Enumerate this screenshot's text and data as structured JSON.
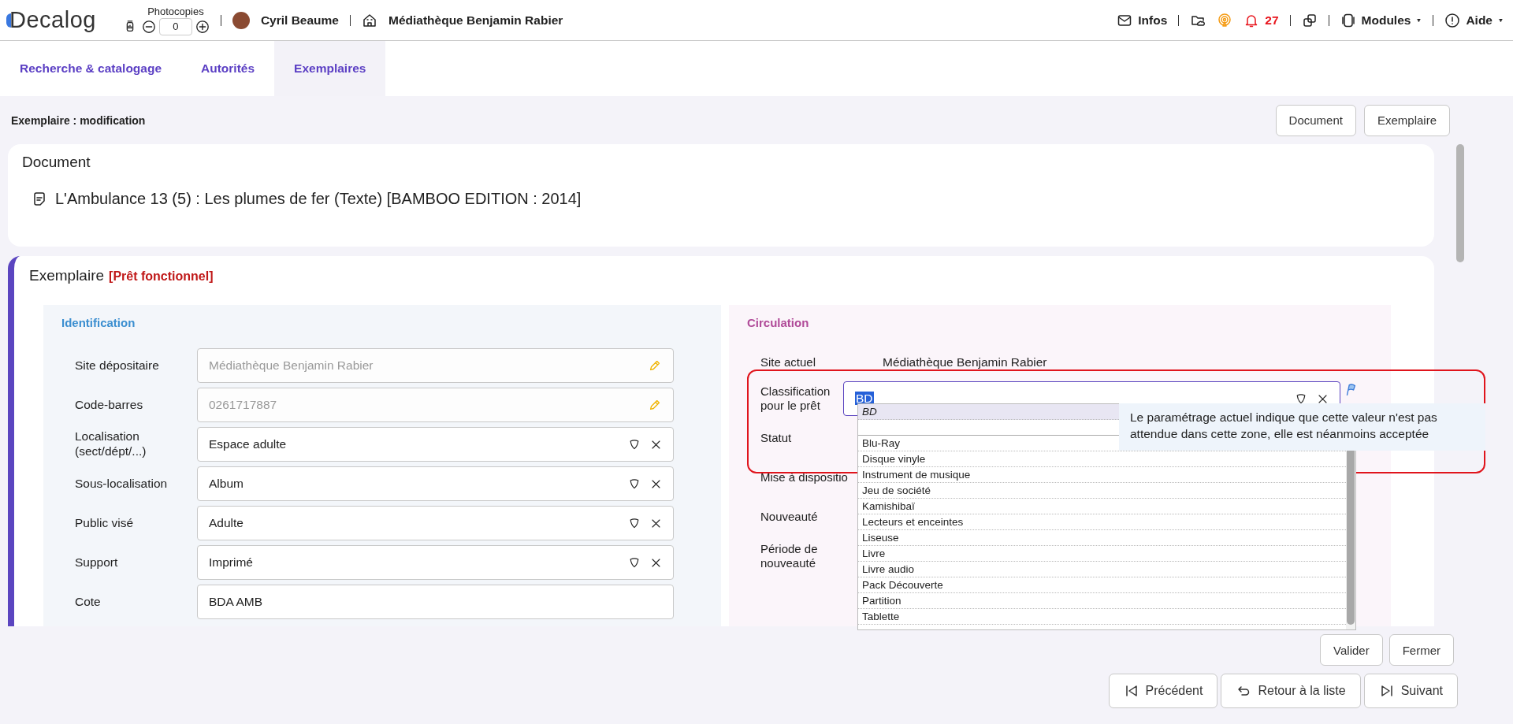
{
  "header": {
    "logo": "Decalog",
    "photocopies_label": "Photocopies",
    "photocopies_value": "0",
    "user": "Cyril Beaume",
    "library": "Médiathèque Benjamin Rabier",
    "infos": "Infos",
    "notifications": "27",
    "modules": "Modules",
    "help": "Aide"
  },
  "tabs": [
    {
      "label": "Recherche & catalogage",
      "selected": false
    },
    {
      "label": "Autorités",
      "selected": false
    },
    {
      "label": "Exemplaires",
      "selected": true
    }
  ],
  "page_title": "Exemplaire : modification",
  "top_buttons": [
    "Document",
    "Exemplaire"
  ],
  "document": {
    "title": "Document",
    "text": "L'Ambulance 13 (5) : Les plumes de fer (Texte) [BAMBOO EDITION : 2014]"
  },
  "exemplaire": {
    "title": "Exemplaire",
    "status": "[Prêt fonctionnel]",
    "identification": {
      "title": "Identification",
      "fields": [
        {
          "label": "Site dépositaire",
          "value": "Médiathèque Benjamin Rabier",
          "kind": "readonly"
        },
        {
          "label": "Code-barres",
          "value": "0261717887",
          "kind": "readonly"
        },
        {
          "label": "Localisation (sect/dépt/...)",
          "value": "Espace adulte",
          "kind": "select"
        },
        {
          "label": "Sous-localisation",
          "value": "Album",
          "kind": "select"
        },
        {
          "label": "Public visé",
          "value": "Adulte",
          "kind": "select"
        },
        {
          "label": "Support",
          "value": "Imprimé",
          "kind": "select"
        },
        {
          "label": "Cote",
          "value": "BDA AMB",
          "kind": "text"
        }
      ]
    },
    "circulation": {
      "title": "Circulation",
      "fields": [
        {
          "label": "Site actuel",
          "value": "Médiathèque Benjamin Rabier",
          "kind": "static"
        },
        {
          "label": "Classification pour le prêt",
          "value": "BD",
          "kind": "combo",
          "highlighted": true
        },
        {
          "label": "Statut",
          "kind": "hidden"
        },
        {
          "label": "Mise à dispositio",
          "kind": "covered"
        },
        {
          "label": "Nouveauté",
          "kind": "hidden"
        },
        {
          "label": "Période de nouveauté",
          "kind": "hidden"
        }
      ]
    }
  },
  "dropdown": {
    "items": [
      {
        "label": "BD",
        "selected": true
      },
      {
        "label": "Blu-Ray",
        "selected": false
      },
      {
        "label": "Disque vinyle",
        "selected": false
      },
      {
        "label": "Instrument de musique",
        "selected": false
      },
      {
        "label": "Jeu de société",
        "selected": false
      },
      {
        "label": "Kamishibaï",
        "selected": false
      },
      {
        "label": "Lecteurs et enceintes",
        "selected": false
      },
      {
        "label": "Liseuse",
        "selected": false
      },
      {
        "label": "Livre",
        "selected": false
      },
      {
        "label": "Livre audio",
        "selected": false
      },
      {
        "label": "Pack Découverte",
        "selected": false
      },
      {
        "label": "Partition",
        "selected": false
      },
      {
        "label": "Tablette",
        "selected": false
      }
    ]
  },
  "tooltip": "Le paramétrage actuel indique que cette valeur n'est pas attendue dans cette zone, elle est néanmoins acceptée",
  "actions": [
    "Valider",
    "Fermer"
  ],
  "navigation": [
    {
      "label": "Précédent",
      "kind": "previous"
    },
    {
      "label": "Retour à la liste",
      "kind": "back"
    },
    {
      "label": "Suivant",
      "kind": "next"
    }
  ]
}
